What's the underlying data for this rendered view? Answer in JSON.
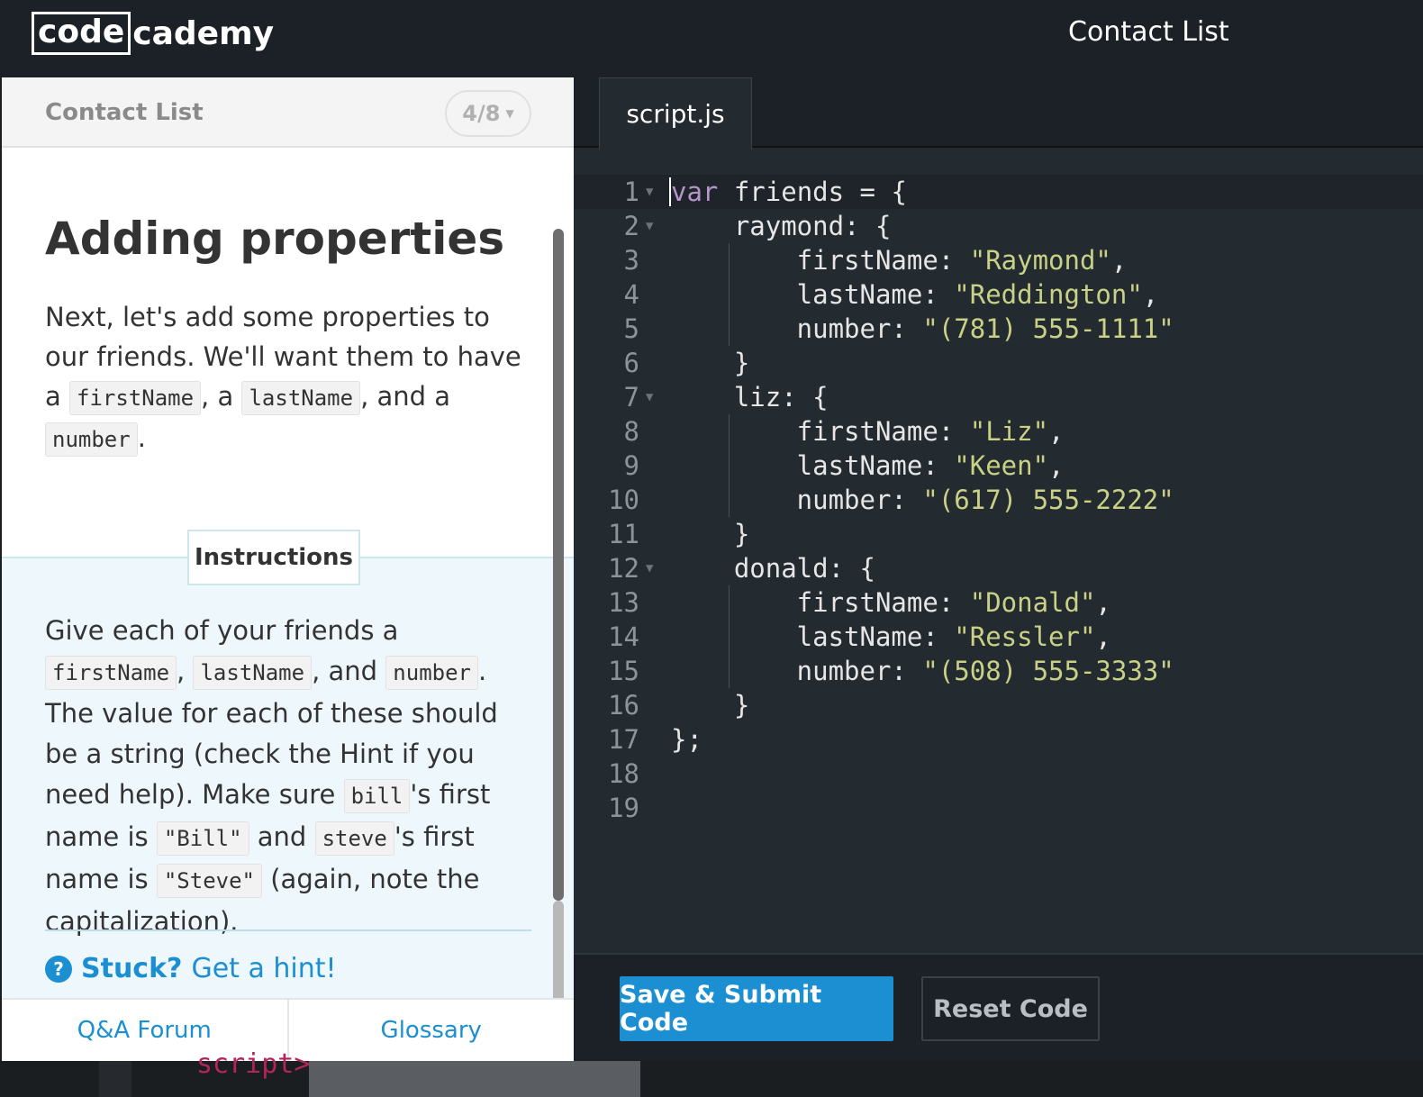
{
  "header": {
    "logo_boxed": "code",
    "logo_rest": "cademy",
    "course_title": "Contact List"
  },
  "lesson": {
    "section": "Contact List",
    "progress": "4/8",
    "title": "Adding properties",
    "intro": {
      "t1": "Next, let's add some properties to our friends. We'll want them to have a ",
      "c1": "firstName",
      "t2": ", a ",
      "c2": "lastName",
      "t3": ", and a ",
      "c3": "number",
      "t4": "."
    },
    "instructions_label": "Instructions",
    "instructions": {
      "t1": "Give each of your friends a ",
      "c1": "firstName",
      "t2": ", ",
      "c2": "lastName",
      "t3": ", and ",
      "c3": "number",
      "t4": ". The value for each of these should be a string (check the Hint if you need help). Make sure ",
      "c4": "bill",
      "t5": "'s first name is ",
      "c5": "\"Bill\"",
      "t6": " and ",
      "c6": "steve",
      "t7": "'s first name is ",
      "c7": "\"Steve\"",
      "t8": " (again, note the capitalization)."
    },
    "hint_strong": "Stuck?",
    "hint_link": "Get a hint!",
    "hint_icon": "question-circle-icon",
    "footer": {
      "forum": "Q&A Forum",
      "glossary": "Glossary"
    }
  },
  "editor": {
    "tab": "script.js",
    "lines": [
      {
        "n": "1"
      },
      {
        "n": "2"
      },
      {
        "n": "3"
      },
      {
        "n": "4"
      },
      {
        "n": "5"
      },
      {
        "n": "6"
      },
      {
        "n": "7"
      },
      {
        "n": "8"
      },
      {
        "n": "9"
      },
      {
        "n": "10"
      },
      {
        "n": "11"
      },
      {
        "n": "12"
      },
      {
        "n": "13"
      },
      {
        "n": "14"
      },
      {
        "n": "15"
      },
      {
        "n": "16"
      },
      {
        "n": "17"
      },
      {
        "n": "18"
      },
      {
        "n": "19"
      }
    ],
    "code": {
      "l1_kw": "var",
      "l1_rest": " friends = {",
      "l2": "    raymond: {",
      "l3_key": "        firstName: ",
      "l3_val": "\"Raymond\"",
      "l4_key": "        lastName: ",
      "l4_val": "\"Reddington\"",
      "l5_key": "        number: ",
      "l5_val": "\"(781) 555-1111\"",
      "l6": "    }",
      "l7": "    liz: {",
      "l8_key": "        firstName: ",
      "l8_val": "\"Liz\"",
      "l9_key": "        lastName: ",
      "l9_val": "\"Keen\"",
      "l10_key": "        number: ",
      "l10_val": "\"(617) 555-2222\"",
      "l11": "    }",
      "l12": "    donald: {",
      "l13_key": "        firstName: ",
      "l13_val": "\"Donald\"",
      "l14_key": "        lastName: ",
      "l14_val": "\"Ressler\"",
      "l15_key": "        number: ",
      "l15_val": "\"(508) 555-3333\"",
      "l16": "    }",
      "l17": "};",
      "comma": ","
    },
    "submit_label": "Save & Submit Code",
    "reset_label": "Reset Code"
  },
  "background_text": "script>",
  "colors": {
    "accent": "#1b8fd1",
    "string": "#c8d186",
    "keyword": "#b794c9",
    "editor_bg": "#232a30"
  }
}
